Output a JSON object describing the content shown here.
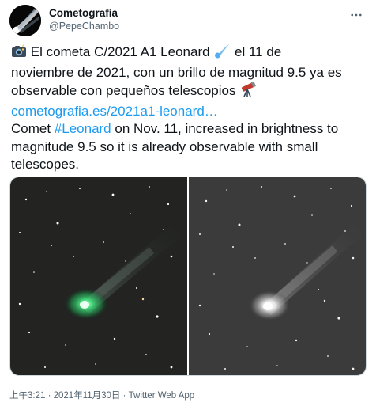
{
  "author": {
    "display_name": "Cometografía",
    "handle": "@PepeChambo"
  },
  "tweet": {
    "lines": [
      "el 11 de",
      "noviembre de 2021, con un brillo de magnitud 9.5 ya es",
      "observable con pequeños telescopios"
    ],
    "line1_text": "El cometa C/2021 A1 Leonard",
    "link": "cometografia.es/2021a1-leonard…",
    "en_line1_pre": "Comet ",
    "hashtag": "#Leonard",
    "en_line1_post": " on Nov. 11,  increased in brightness to",
    "en_line2": "magnitude 9.5 so it is already observable with small",
    "en_line3": "telescopes."
  },
  "meta": {
    "time": "上午3:21",
    "separator": " · ",
    "date": "2021年11月30日",
    "source": "Twitter Web App"
  },
  "icons": {
    "camera": "camera-with-flash-emoji",
    "comet": "comet-emoji",
    "telescope": "telescope-emoji",
    "more": "more-options-icon"
  },
  "colors": {
    "link": "#1d9bf0",
    "text": "#0f1419",
    "secondary": "#536471",
    "comet_green": "#3fd77a"
  }
}
